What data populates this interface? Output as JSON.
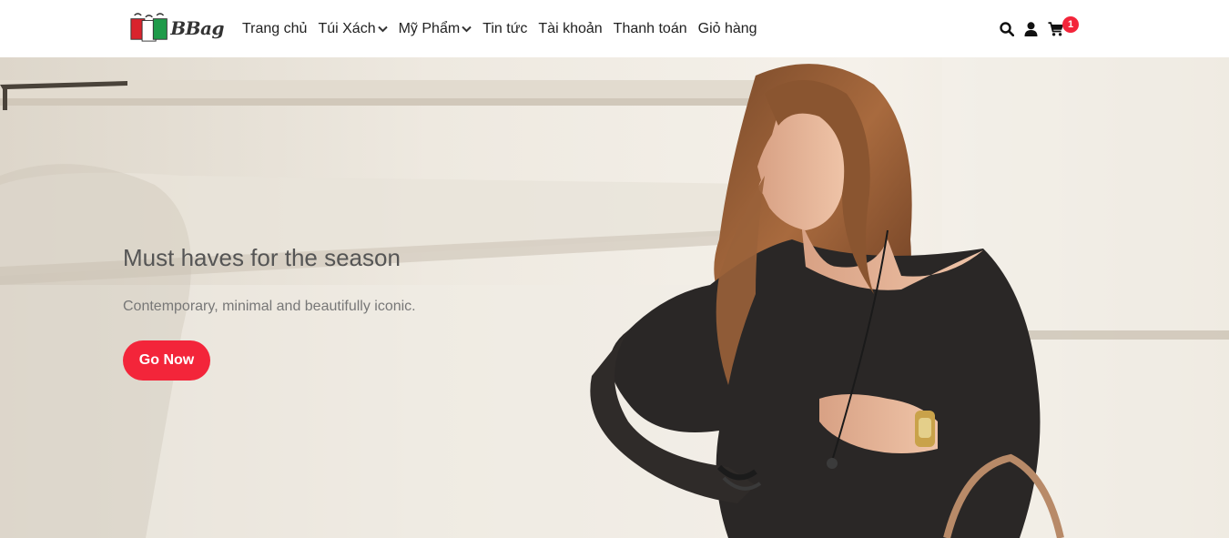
{
  "brand": {
    "name": "BBag"
  },
  "nav": {
    "items": [
      {
        "label": "Trang chủ",
        "dropdown": false
      },
      {
        "label": "Túi Xách",
        "dropdown": true
      },
      {
        "label": "Mỹ Phẩm",
        "dropdown": true
      },
      {
        "label": "Tin tức",
        "dropdown": false
      },
      {
        "label": "Tài khoản",
        "dropdown": false
      },
      {
        "label": "Thanh toán",
        "dropdown": false
      },
      {
        "label": "Giỏ hàng",
        "dropdown": false
      }
    ]
  },
  "tools": {
    "icons": [
      "search-icon",
      "user-icon",
      "cart-icon"
    ],
    "cart_count": "1"
  },
  "hero": {
    "title": "Must haves for the season",
    "subtitle": "Contemporary, minimal and beautifully iconic.",
    "button_label": "Go Now"
  },
  "colors": {
    "accent": "#f3253a",
    "text": "#222222"
  }
}
